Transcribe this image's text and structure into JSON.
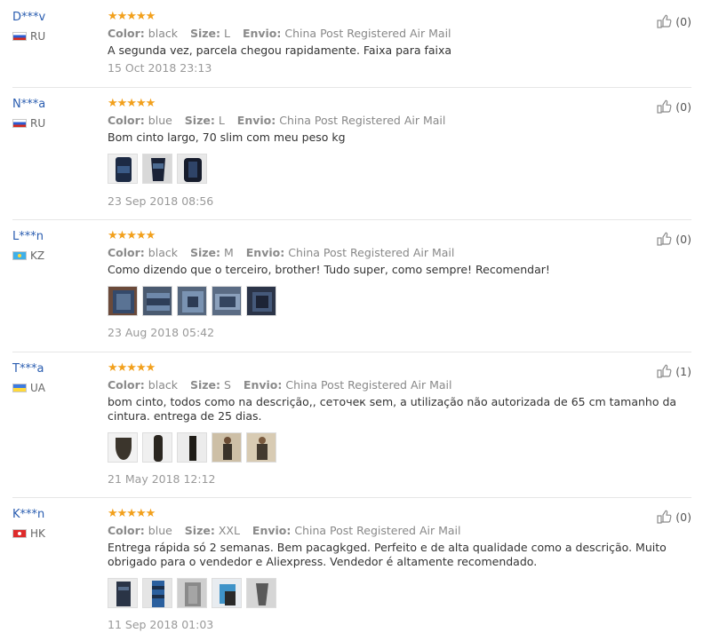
{
  "labels": {
    "color": "Color:",
    "size": "Size:",
    "envio": "Envio:"
  },
  "icons": {
    "stars": "five-star-rating",
    "helpful": "thumbs-up-icon"
  },
  "reviews": [
    {
      "user": "D***v",
      "country": "RU",
      "stars": "★★★★★",
      "rating": 5,
      "color": "black",
      "size": "L",
      "shipping": "China Post Registered Air Mail",
      "text": "A segunda vez, parcela chegou rapidamente. Faixa para faixa",
      "date": "15 Oct 2018 23:13",
      "helpful": "(0)",
      "photo_count": 0
    },
    {
      "user": "N***a",
      "country": "RU",
      "stars": "★★★★★",
      "rating": 5,
      "color": "blue",
      "size": "L",
      "shipping": "China Post Registered Air Mail",
      "text": "Bom cinto largo, 70 slim com meu peso kg",
      "date": "23 Sep 2018 08:56",
      "helpful": "(0)",
      "photo_count": 3
    },
    {
      "user": "L***n",
      "country": "KZ",
      "stars": "★★★★★",
      "rating": 5,
      "color": "black",
      "size": "M",
      "shipping": "China Post Registered Air Mail",
      "text": "Como dizendo que o terceiro, brother! Tudo super, como sempre! Recomendar!",
      "date": "23 Aug 2018 05:42",
      "helpful": "(0)",
      "photo_count": 5
    },
    {
      "user": "T***a",
      "country": "UA",
      "stars": "★★★★★",
      "rating": 5,
      "color": "black",
      "size": "S",
      "shipping": "China Post Registered Air Mail",
      "text": "bom cinto, todos como na descrição,, сеточек sem, a utilização não autorizada de 65 cm tamanho da cintura. entrega de 25 dias.",
      "date": "21 May 2018 12:12",
      "helpful": "(1)",
      "photo_count": 5
    },
    {
      "user": "K***n",
      "country": "HK",
      "stars": "★★★★★",
      "rating": 5,
      "color": "blue",
      "size": "XXL",
      "shipping": "China Post Registered Air Mail",
      "text": "Entrega rápida só 2 semanas. Bem pacagkged. Perfeito e de alta qualidade como a descrição. Muito obrigado para o vendedor e Aliexpress. Vendedor é altamente recomendado.",
      "date": "11 Sep 2018 01:03",
      "helpful": "(0)",
      "photo_count": 5
    }
  ]
}
